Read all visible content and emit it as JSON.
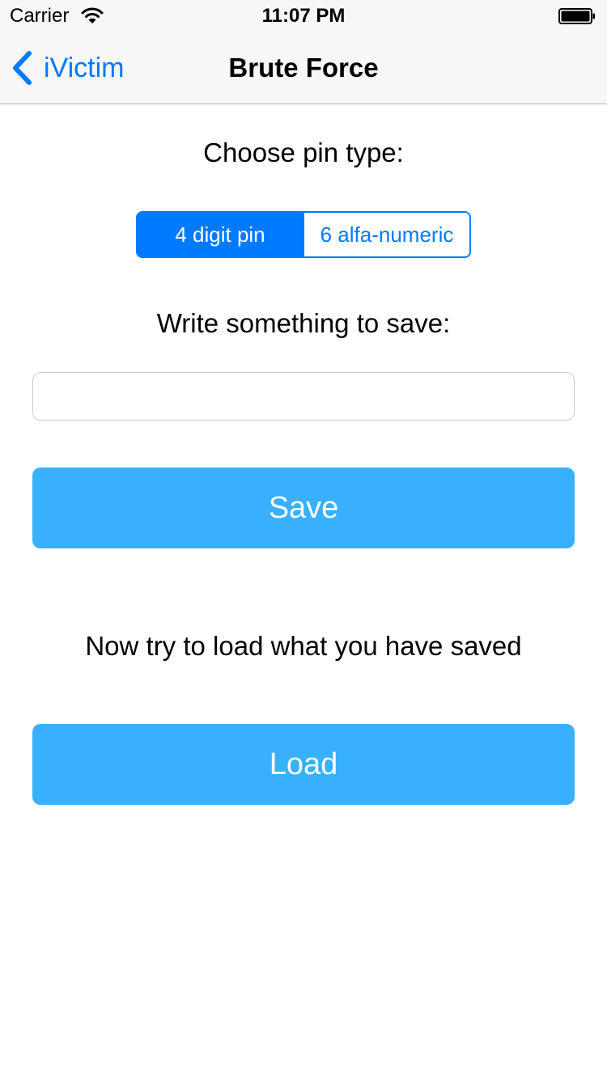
{
  "status_bar": {
    "carrier": "Carrier",
    "time": "11:07 PM",
    "wifi_icon": "wifi-icon",
    "battery_icon": "battery-icon"
  },
  "nav": {
    "back_label": "iVictim",
    "back_icon": "chevron-left-icon",
    "title": "Brute Force"
  },
  "main": {
    "pin_type_label": "Choose pin type:",
    "segments": [
      {
        "label": "4 digit pin",
        "selected": true
      },
      {
        "label": "6 alfa-numeric",
        "selected": false
      }
    ],
    "save_prompt": "Write something to save:",
    "input": {
      "value": "",
      "placeholder": ""
    },
    "save_label": "Save",
    "load_prompt": "Now try to load what you have saved",
    "load_label": "Load"
  },
  "colors": {
    "accent": "#007aff",
    "button": "#38b0fd",
    "navbar": "#f7f7f7"
  }
}
